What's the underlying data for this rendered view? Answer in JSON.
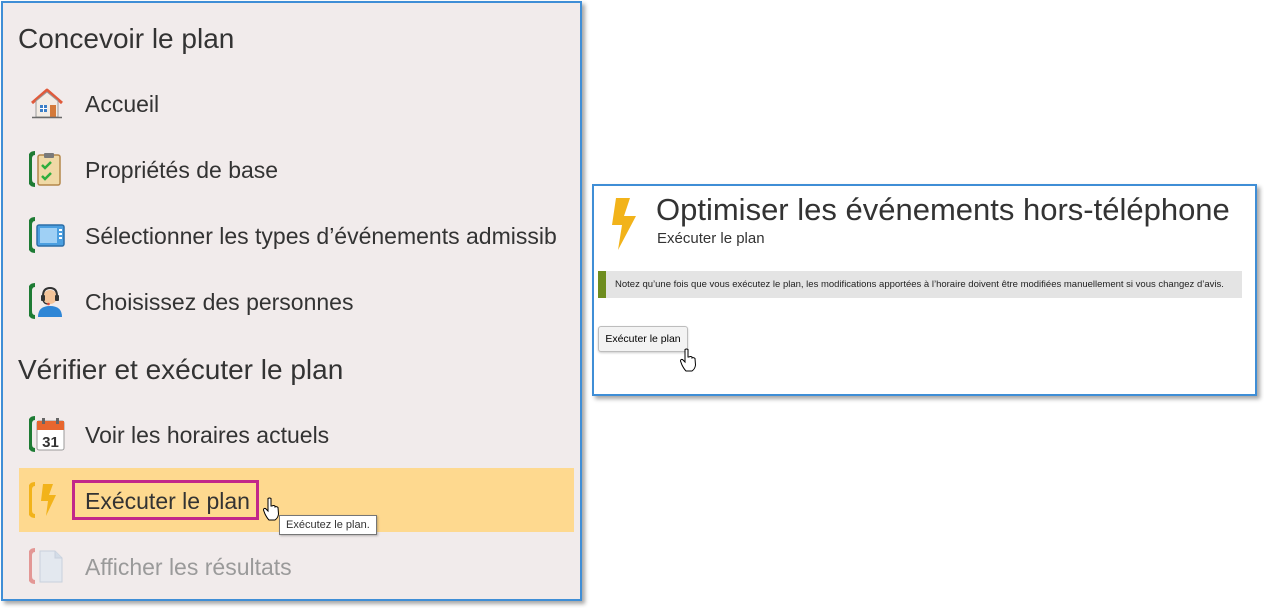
{
  "nav": {
    "sections": [
      {
        "title": "Concevoir le plan",
        "items": [
          {
            "label": "Accueil",
            "icon": "home-icon"
          },
          {
            "label": "Propriétés de base",
            "icon": "clipboard-check-icon"
          },
          {
            "label": "Sélectionner les types d’événements admissib",
            "icon": "monitor-icon"
          },
          {
            "label": "Choisissez des personnes",
            "icon": "agent-headset-icon"
          }
        ]
      },
      {
        "title": "Vérifier et exécuter le plan",
        "items": [
          {
            "label": "Voir les horaires actuels",
            "icon": "calendar-icon",
            "calendar_day": "31"
          },
          {
            "label": "Exécuter le plan",
            "icon": "lightning-icon",
            "state": "active"
          },
          {
            "label": "Afficher les résultats",
            "icon": "document-icon",
            "state": "disabled"
          }
        ]
      }
    ],
    "tooltip": "Exécutez le plan."
  },
  "detail": {
    "title": "Optimiser les événements hors-téléphone",
    "subtitle": "Exécuter le plan",
    "notice": "Notez qu’une fois que vous exécutez le plan, les modifications apportées à l’horaire doivent être modifiées manuellement si vous changez d’avis.",
    "run_button_label": "Exécuter le plan"
  },
  "colors": {
    "panel_border": "#3f8ed6",
    "nav_background": "#f1ebeb",
    "active_item": "#fed98f",
    "highlight": "#c2278a",
    "notice_accent": "#6e8d1f",
    "status_green": "#1e7b34",
    "lightning": "#f2b31a"
  }
}
